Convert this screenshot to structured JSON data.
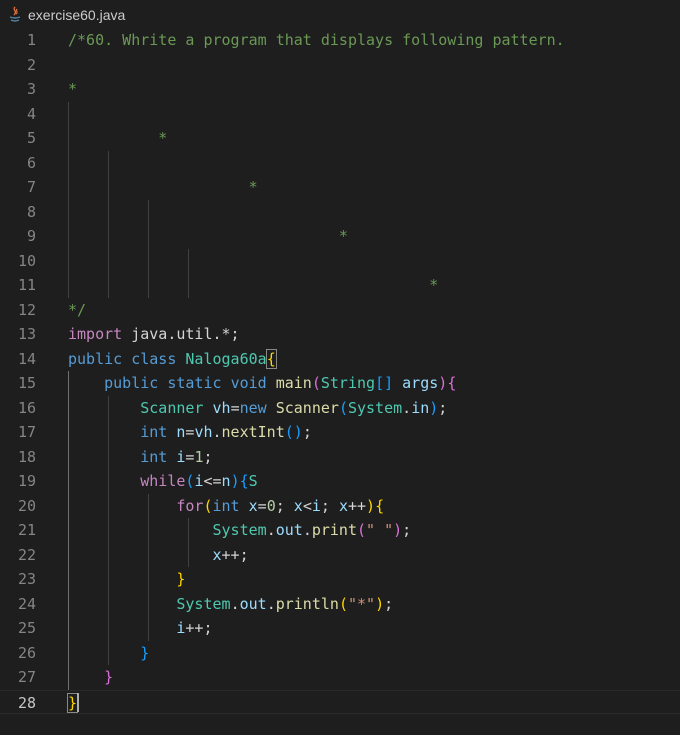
{
  "tab": {
    "filename": "exercise60.java",
    "icon": "java-file-icon"
  },
  "editor": {
    "active_line": 28,
    "lines": [
      {
        "n": "1",
        "tokens": [
          [
            "comment",
            "/*60. Whrite a program that displays following pattern."
          ]
        ]
      },
      {
        "n": "2",
        "tokens": []
      },
      {
        "n": "3",
        "tokens": [
          [
            "comment",
            "*"
          ]
        ]
      },
      {
        "n": "4",
        "tokens": []
      },
      {
        "n": "5",
        "tokens": [
          [
            "comment",
            "          *"
          ]
        ]
      },
      {
        "n": "6",
        "tokens": []
      },
      {
        "n": "7",
        "tokens": [
          [
            "comment",
            "                    *"
          ]
        ]
      },
      {
        "n": "8",
        "tokens": []
      },
      {
        "n": "9",
        "tokens": [
          [
            "comment",
            "                              *"
          ]
        ]
      },
      {
        "n": "10",
        "tokens": []
      },
      {
        "n": "11",
        "tokens": [
          [
            "comment",
            "                                        *"
          ]
        ]
      },
      {
        "n": "12",
        "tokens": [
          [
            "comment",
            "*/"
          ]
        ]
      },
      {
        "n": "13",
        "tokens": [
          [
            "ctl",
            "import"
          ],
          [
            "plain",
            " java.util.*;"
          ]
        ]
      },
      {
        "n": "14",
        "tokens": [
          [
            "kw",
            "public"
          ],
          [
            "plain",
            " "
          ],
          [
            "kw",
            "class"
          ],
          [
            "plain",
            " "
          ],
          [
            "type",
            "Naloga60a"
          ],
          [
            "b1 bm",
            "{"
          ]
        ]
      },
      {
        "n": "15",
        "tokens": [
          [
            "plain",
            "    "
          ],
          [
            "kw",
            "public"
          ],
          [
            "plain",
            " "
          ],
          [
            "kw",
            "static"
          ],
          [
            "plain",
            " "
          ],
          [
            "kw",
            "void"
          ],
          [
            "plain",
            " "
          ],
          [
            "fn",
            "main"
          ],
          [
            "b2",
            "("
          ],
          [
            "type",
            "String"
          ],
          [
            "b3",
            "[]"
          ],
          [
            "plain",
            " "
          ],
          [
            "var",
            "args"
          ],
          [
            "b2",
            ")"
          ],
          [
            "b2",
            "{"
          ]
        ]
      },
      {
        "n": "16",
        "tokens": [
          [
            "plain",
            "        "
          ],
          [
            "type",
            "Scanner"
          ],
          [
            "plain",
            " "
          ],
          [
            "var",
            "vh"
          ],
          [
            "plain",
            "="
          ],
          [
            "kw",
            "new"
          ],
          [
            "plain",
            " "
          ],
          [
            "fn",
            "Scanner"
          ],
          [
            "b3",
            "("
          ],
          [
            "type",
            "System"
          ],
          [
            "plain",
            "."
          ],
          [
            "var",
            "in"
          ],
          [
            "b3",
            ")"
          ],
          [
            "plain",
            ";"
          ]
        ]
      },
      {
        "n": "17",
        "tokens": [
          [
            "plain",
            "        "
          ],
          [
            "kw",
            "int"
          ],
          [
            "plain",
            " "
          ],
          [
            "var",
            "n"
          ],
          [
            "plain",
            "="
          ],
          [
            "var",
            "vh"
          ],
          [
            "plain",
            "."
          ],
          [
            "fn",
            "nextInt"
          ],
          [
            "b3",
            "()"
          ],
          [
            "plain",
            ";"
          ]
        ]
      },
      {
        "n": "18",
        "tokens": [
          [
            "plain",
            "        "
          ],
          [
            "kw",
            "int"
          ],
          [
            "plain",
            " "
          ],
          [
            "var",
            "i"
          ],
          [
            "plain",
            "="
          ],
          [
            "num",
            "1"
          ],
          [
            "plain",
            ";"
          ]
        ]
      },
      {
        "n": "19",
        "tokens": [
          [
            "plain",
            "        "
          ],
          [
            "ctl",
            "while"
          ],
          [
            "b3",
            "("
          ],
          [
            "var",
            "i"
          ],
          [
            "plain",
            "<="
          ],
          [
            "var",
            "n"
          ],
          [
            "b3",
            ")"
          ],
          [
            "b3",
            "{"
          ],
          [
            "type",
            "S"
          ]
        ]
      },
      {
        "n": "20",
        "tokens": [
          [
            "plain",
            "            "
          ],
          [
            "ctl",
            "for"
          ],
          [
            "b1",
            "("
          ],
          [
            "kw",
            "int"
          ],
          [
            "plain",
            " "
          ],
          [
            "var",
            "x"
          ],
          [
            "plain",
            "="
          ],
          [
            "num",
            "0"
          ],
          [
            "plain",
            "; "
          ],
          [
            "var",
            "x"
          ],
          [
            "plain",
            "<"
          ],
          [
            "var",
            "i"
          ],
          [
            "plain",
            "; "
          ],
          [
            "var",
            "x"
          ],
          [
            "plain",
            "++"
          ],
          [
            "b1",
            ")"
          ],
          [
            "b1",
            "{"
          ]
        ]
      },
      {
        "n": "21",
        "tokens": [
          [
            "plain",
            "                "
          ],
          [
            "type",
            "System"
          ],
          [
            "plain",
            "."
          ],
          [
            "var",
            "out"
          ],
          [
            "plain",
            "."
          ],
          [
            "fn",
            "print"
          ],
          [
            "b2",
            "("
          ],
          [
            "str",
            "\" \""
          ],
          [
            "b2",
            ")"
          ],
          [
            "plain",
            ";"
          ]
        ]
      },
      {
        "n": "22",
        "tokens": [
          [
            "plain",
            "                "
          ],
          [
            "var",
            "x"
          ],
          [
            "plain",
            "++;"
          ]
        ]
      },
      {
        "n": "23",
        "tokens": [
          [
            "plain",
            "            "
          ],
          [
            "b1",
            "}"
          ]
        ]
      },
      {
        "n": "24",
        "tokens": [
          [
            "plain",
            "            "
          ],
          [
            "type",
            "System"
          ],
          [
            "plain",
            "."
          ],
          [
            "var",
            "out"
          ],
          [
            "plain",
            "."
          ],
          [
            "fn",
            "println"
          ],
          [
            "b1",
            "("
          ],
          [
            "str",
            "\"*\""
          ],
          [
            "b1",
            ")"
          ],
          [
            "plain",
            ";"
          ]
        ]
      },
      {
        "n": "25",
        "tokens": [
          [
            "plain",
            "            "
          ],
          [
            "var",
            "i"
          ],
          [
            "plain",
            "++;"
          ]
        ]
      },
      {
        "n": "26",
        "tokens": [
          [
            "plain",
            "        "
          ],
          [
            "b3",
            "}"
          ]
        ]
      },
      {
        "n": "27",
        "tokens": [
          [
            "plain",
            "    "
          ],
          [
            "b2",
            "}"
          ]
        ]
      },
      {
        "n": "28",
        "tokens": [
          [
            "b1 bm",
            "}"
          ]
        ]
      }
    ]
  },
  "colors": {
    "background": "#1e1e1e",
    "comment": "#6a9955",
    "keyword": "#569cd6",
    "control": "#c586c0",
    "type": "#4ec9b0",
    "variable": "#9cdcfe",
    "function": "#dcdcaa",
    "string": "#ce9178",
    "number": "#b5cea8"
  }
}
